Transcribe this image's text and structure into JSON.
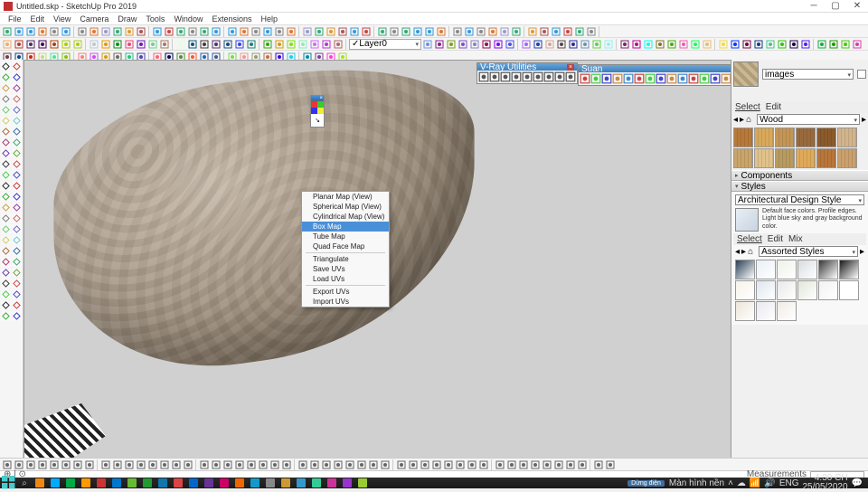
{
  "title": "Untitled.skp - SketchUp Pro 2019",
  "menubar": [
    "File",
    "Edit",
    "View",
    "Camera",
    "Draw",
    "Tools",
    "Window",
    "Extensions",
    "Help"
  ],
  "layer_combo": "Layer0",
  "context_menu": {
    "items": [
      "Planar Map (View)",
      "Spherical Map (View)",
      "Cylindrical Map (View)",
      "Box Map",
      "Tube Map",
      "Quad Face Map"
    ],
    "group2": [
      "Triangulate",
      "Save UVs",
      "Load UVs"
    ],
    "group3": [
      "Export UVs",
      "Import UVs"
    ],
    "highlighted": "Box Map"
  },
  "floatbars": {
    "vray": {
      "title": "V-Ray Utilities"
    },
    "suan": {
      "title": "Suan"
    }
  },
  "rpanel": {
    "materials": {
      "image_name": "images",
      "tabs": [
        "Select",
        "Edit"
      ],
      "collection": "Wood"
    },
    "components": {
      "title": "Components"
    },
    "styles": {
      "title": "Styles",
      "name": "Architectural Design Style",
      "desc": "Default face colors. Profile edges. Light blue sky and gray background color.",
      "tabs": [
        "Select",
        "Edit",
        "Mix"
      ],
      "collection": "Assorted Styles"
    }
  },
  "status": {
    "hint": "⊕ | ⊙",
    "measurements_label": "Measurements"
  },
  "taskbar": {
    "dung": "Dừng điện",
    "desktop": "Màn hình nền",
    "lang": "ENG",
    "time": "4:30 CH",
    "date": "25/05/2020"
  },
  "wood_swatches": [
    "#b87939",
    "#d9a95a",
    "#c49656",
    "#9a6a3c",
    "#8b5a2b",
    "#d2b48c",
    "#c9a46b",
    "#e0c28a",
    "#b89b61",
    "#dfaa59",
    "#b8763b",
    "#caa06c"
  ],
  "style_thumbs_row1": [
    "#2a3f55",
    "#e8eff5",
    "#eef1e8",
    "#d8dce0",
    "#383838",
    "#1a1a1a"
  ],
  "style_thumbs_row2": [
    "#f5f3e8",
    "#dde6ee",
    "#e8e8e8",
    "#e0e6d8",
    "#f2f2f2",
    "#ffffff"
  ],
  "style_thumbs_row3": [
    "#ece5d8",
    "#e8e8f0",
    "#f0ece4"
  ]
}
